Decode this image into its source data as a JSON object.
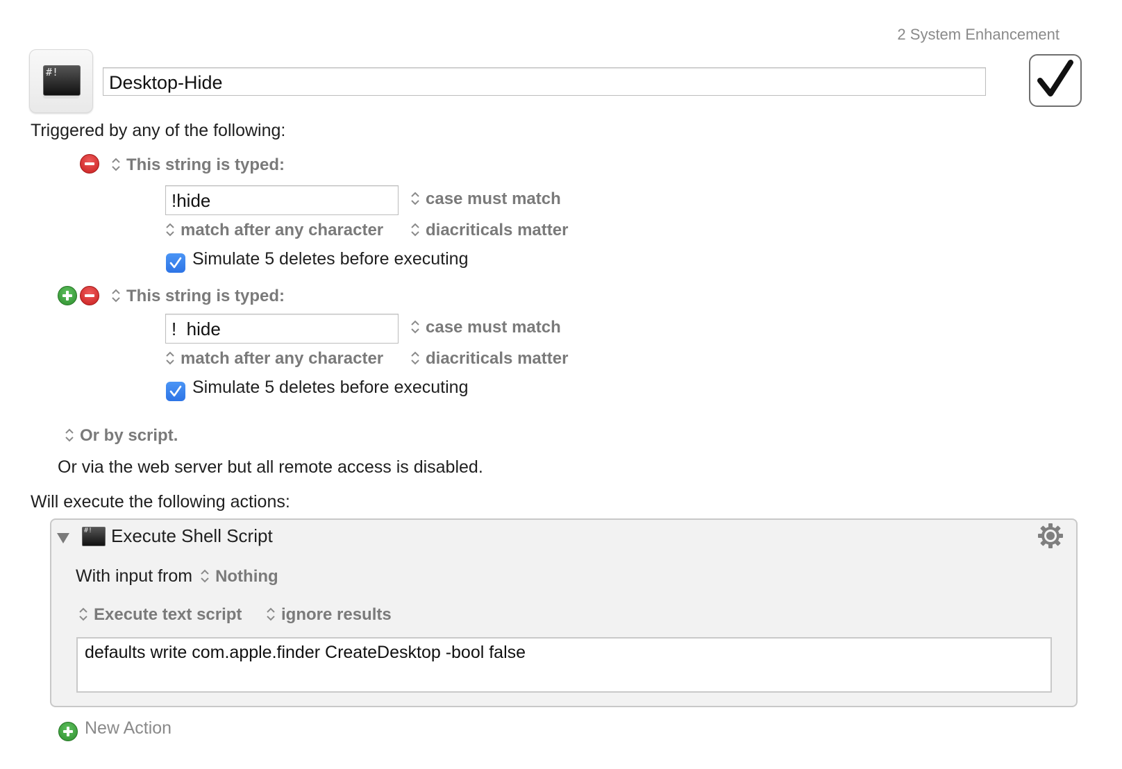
{
  "header": {
    "group_name": "2 System Enhancement",
    "macro_name": "Desktop-Hide",
    "macro_icon": "terminal-icon",
    "enabled": true
  },
  "triggers": {
    "heading": "Triggered by any of the following:",
    "items": [
      {
        "type_label": "This string is typed:",
        "string_value": "!hide",
        "case_option": "case must match",
        "match_option": "match after any character",
        "diacritics_option": "diacriticals matter",
        "simulate_checked": true,
        "simulate_label": "Simulate 5 deletes before executing"
      },
      {
        "type_label": "This string is typed:",
        "string_value": "!  hide",
        "case_option": "case must match",
        "match_option": "match after any character",
        "diacritics_option": "diacriticals matter",
        "simulate_checked": true,
        "simulate_label": "Simulate 5 deletes before executing"
      }
    ],
    "script_option": "Or by script.",
    "web_server_text": "Or via the web server but all remote access is disabled."
  },
  "actions": {
    "heading": "Will execute the following actions:",
    "items": [
      {
        "title": "Execute Shell Script",
        "input_label": "With input from",
        "input_value": "Nothing",
        "execute_option": "Execute text script",
        "results_option": "ignore results",
        "script": "defaults write com.apple.finder CreateDesktop -bool false"
      }
    ],
    "new_action_label": "New Action"
  },
  "colors": {
    "remove_button": "#c81f1f",
    "add_button": "#2f8f2f",
    "checkbox_accent": "#2d74e6"
  }
}
